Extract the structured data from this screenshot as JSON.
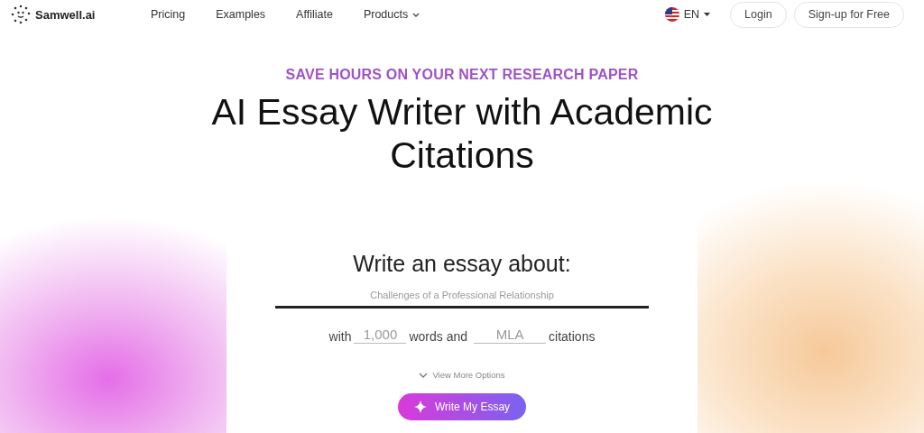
{
  "nav": {
    "logo": "Samwell.ai",
    "links": [
      {
        "label": "Pricing",
        "dropdown": false
      },
      {
        "label": "Examples",
        "dropdown": false
      },
      {
        "label": "Affiliate",
        "dropdown": false
      },
      {
        "label": "Products",
        "dropdown": true
      }
    ],
    "language": "EN",
    "login": "Login",
    "signup": "Sign-up for Free"
  },
  "hero": {
    "eyebrow": "SAVE HOURS ON YOUR NEXT RESEARCH PAPER",
    "title": "AI Essay Writer with Academic Citations"
  },
  "form": {
    "heading": "Write an essay about:",
    "topic": {
      "placeholder": "Challenges of a Professional Relationship"
    },
    "with": "with",
    "words": {
      "placeholder": "1,000"
    },
    "words_and": "words and",
    "citation": {
      "placeholder": "MLA"
    },
    "citations": "citations",
    "more_options": "View More Options",
    "submit": "Write My Essay"
  }
}
